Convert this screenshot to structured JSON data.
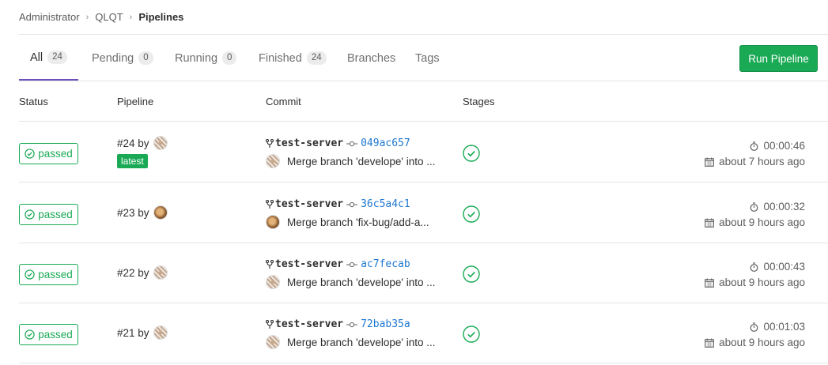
{
  "breadcrumb": {
    "items": [
      "Administrator",
      "QLQT"
    ],
    "current": "Pipelines"
  },
  "tabs": [
    {
      "label": "All",
      "count": "24"
    },
    {
      "label": "Pending",
      "count": "0"
    },
    {
      "label": "Running",
      "count": "0"
    },
    {
      "label": "Finished",
      "count": "24"
    },
    {
      "label": "Branches"
    },
    {
      "label": "Tags"
    }
  ],
  "run_button": "Run Pipeline",
  "columns": {
    "status": "Status",
    "pipeline": "Pipeline",
    "commit": "Commit",
    "stages": "Stages"
  },
  "colors": {
    "success": "#1aaa55",
    "link": "#1f78d1",
    "active_tab": "#6b4fbb"
  },
  "pipelines": [
    {
      "status": "passed",
      "id": "#24",
      "by": "by",
      "avatar": "pattern-avatar",
      "badge": "latest",
      "branch": "test-server",
      "sha": "049ac657",
      "commit_avatar": "pattern-avatar",
      "message": "Merge branch 'develope' into ...",
      "stage": "passed",
      "duration": "00:00:46",
      "finished": "about 7 hours ago"
    },
    {
      "status": "passed",
      "id": "#23",
      "by": "by",
      "avatar": "photo-avatar",
      "branch": "test-server",
      "sha": "36c5a4c1",
      "commit_avatar": "photo-avatar",
      "message": "Merge branch 'fix-bug/add-a...",
      "stage": "passed",
      "duration": "00:00:32",
      "finished": "about 9 hours ago"
    },
    {
      "status": "passed",
      "id": "#22",
      "by": "by",
      "avatar": "pattern-avatar",
      "branch": "test-server",
      "sha": "ac7fecab",
      "commit_avatar": "pattern-avatar",
      "message": "Merge branch 'develope' into ...",
      "stage": "passed",
      "duration": "00:00:43",
      "finished": "about 9 hours ago"
    },
    {
      "status": "passed",
      "id": "#21",
      "by": "by",
      "avatar": "pattern-avatar",
      "branch": "test-server",
      "sha": "72bab35a",
      "commit_avatar": "pattern-avatar",
      "message": "Merge branch 'develope' into ...",
      "stage": "passed",
      "duration": "00:01:03",
      "finished": "about 9 hours ago"
    }
  ]
}
